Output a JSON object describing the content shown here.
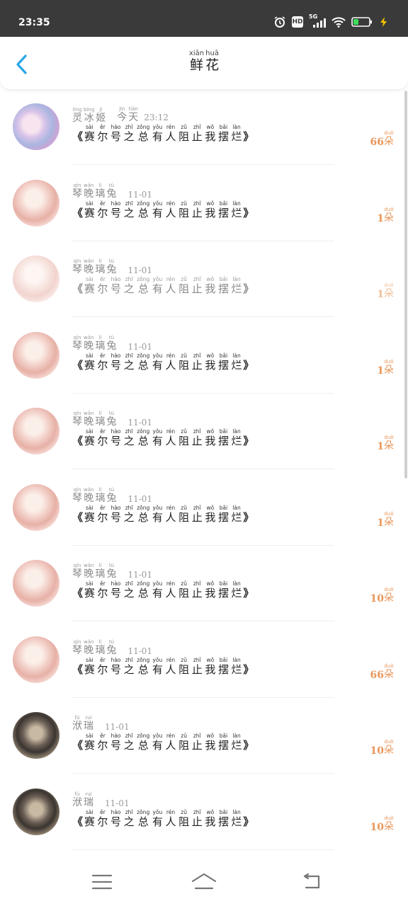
{
  "status_bar": {
    "time": "23:35",
    "icons": [
      "alarm-icon",
      "hd-icon",
      "signal-5g-icon",
      "wifi-icon",
      "battery-icon",
      "charging-icon"
    ],
    "hd_label": "HD",
    "network_label": "5G"
  },
  "header": {
    "title": [
      {
        "char": "鲜",
        "pinyin": "xiān"
      },
      {
        "char": "花",
        "pinyin": "huā"
      }
    ],
    "back_icon": "chevron-left-icon"
  },
  "colors": {
    "accent": "#2aa5e6",
    "count_color": "#e8965a",
    "status_bar_bg": "#3a3a3a"
  },
  "list": [
    {
      "avatar": "av-a",
      "faded": false,
      "time": "今天 23:12",
      "name": [
        {
          "c": "灵",
          "p": "líng"
        },
        {
          "c": "冰",
          "p": "bīng"
        },
        {
          "c": "姬",
          "p": "jī"
        }
      ],
      "time_ruby": [
        {
          "c": "今",
          "p": "jīn"
        },
        {
          "c": "天",
          "p": "tiān"
        }
      ],
      "time_rest": "23:12",
      "count": "66",
      "unit": {
        "c": "朵",
        "p": "duǒ"
      }
    },
    {
      "avatar": "av-b",
      "faded": false,
      "time": "11-01",
      "name": [
        {
          "c": "琴",
          "p": "qín"
        },
        {
          "c": "晚",
          "p": "wǎn"
        },
        {
          "c": "璃",
          "p": "lí"
        },
        {
          "c": "兔",
          "p": "tù"
        }
      ],
      "count": "1",
      "unit": {
        "c": "朵",
        "p": "duǒ"
      }
    },
    {
      "avatar": "av-b",
      "faded": true,
      "time": "11-01",
      "name": [
        {
          "c": "琴",
          "p": "qín"
        },
        {
          "c": "晚",
          "p": "wǎn"
        },
        {
          "c": "璃",
          "p": "lí"
        },
        {
          "c": "兔",
          "p": "tù"
        }
      ],
      "count": "1",
      "unit": {
        "c": "朵",
        "p": "duǒ"
      }
    },
    {
      "avatar": "av-b",
      "faded": false,
      "time": "11-01",
      "name": [
        {
          "c": "琴",
          "p": "qín"
        },
        {
          "c": "晚",
          "p": "wǎn"
        },
        {
          "c": "璃",
          "p": "lí"
        },
        {
          "c": "兔",
          "p": "tù"
        }
      ],
      "count": "1",
      "unit": {
        "c": "朵",
        "p": "duǒ"
      }
    },
    {
      "avatar": "av-b",
      "faded": false,
      "time": "11-01",
      "name": [
        {
          "c": "琴",
          "p": "qín"
        },
        {
          "c": "晚",
          "p": "wǎn"
        },
        {
          "c": "璃",
          "p": "lí"
        },
        {
          "c": "兔",
          "p": "tù"
        }
      ],
      "count": "1",
      "unit": {
        "c": "朵",
        "p": "duǒ"
      }
    },
    {
      "avatar": "av-b",
      "faded": false,
      "time": "11-01",
      "name": [
        {
          "c": "琴",
          "p": "qín"
        },
        {
          "c": "晚",
          "p": "wǎn"
        },
        {
          "c": "璃",
          "p": "lí"
        },
        {
          "c": "兔",
          "p": "tù"
        }
      ],
      "count": "1",
      "unit": {
        "c": "朵",
        "p": "duǒ"
      }
    },
    {
      "avatar": "av-b",
      "faded": false,
      "time": "11-01",
      "name": [
        {
          "c": "琴",
          "p": "qín"
        },
        {
          "c": "晚",
          "p": "wǎn"
        },
        {
          "c": "璃",
          "p": "lí"
        },
        {
          "c": "兔",
          "p": "tù"
        }
      ],
      "count": "10",
      "unit": {
        "c": "朵",
        "p": "duǒ"
      }
    },
    {
      "avatar": "av-b",
      "faded": false,
      "time": "11-01",
      "name": [
        {
          "c": "琴",
          "p": "qín"
        },
        {
          "c": "晚",
          "p": "wǎn"
        },
        {
          "c": "璃",
          "p": "lí"
        },
        {
          "c": "兔",
          "p": "tù"
        }
      ],
      "count": "66",
      "unit": {
        "c": "朵",
        "p": "duǒ"
      }
    },
    {
      "avatar": "av-c",
      "faded": false,
      "time": "11-01",
      "name": [
        {
          "c": "洑",
          "p": "fú"
        },
        {
          "c": "瑞",
          "p": "ruì"
        }
      ],
      "count": "10",
      "unit": {
        "c": "朵",
        "p": "duǒ"
      }
    },
    {
      "avatar": "av-c",
      "faded": false,
      "time": "11-01",
      "name": [
        {
          "c": "洑",
          "p": "fú"
        },
        {
          "c": "瑞",
          "p": "ruì"
        }
      ],
      "count": "10",
      "unit": {
        "c": "朵",
        "p": "duǒ"
      }
    }
  ],
  "message": {
    "open": "《",
    "close": "》",
    "chars": [
      {
        "c": "赛",
        "p": "sài"
      },
      {
        "c": "尔",
        "p": "ěr"
      },
      {
        "c": "号",
        "p": "hào"
      },
      {
        "c": "之",
        "p": "zhī"
      },
      {
        "c": "总",
        "p": "zǒng"
      },
      {
        "c": "有",
        "p": "yǒu"
      },
      {
        "c": "人",
        "p": "rén"
      },
      {
        "c": "阻",
        "p": "zǔ"
      },
      {
        "c": "止",
        "p": "zhǐ"
      },
      {
        "c": "我",
        "p": "wǒ"
      },
      {
        "c": "摆",
        "p": "bǎi"
      },
      {
        "c": "烂",
        "p": "làn"
      }
    ]
  },
  "nav_bar": {
    "menu_icon": "menu-icon",
    "home_icon": "home-icon",
    "back_icon": "back-icon"
  }
}
